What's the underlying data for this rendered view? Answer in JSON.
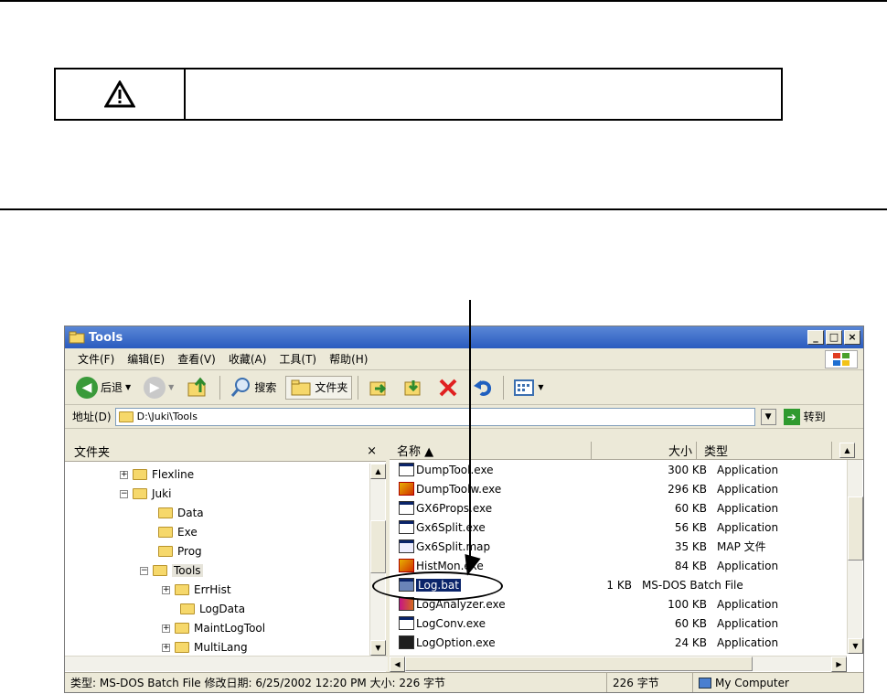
{
  "window": {
    "title": "Tools",
    "buttons": [
      "_",
      "□",
      "×"
    ]
  },
  "menu": [
    "文件(F)",
    "编辑(E)",
    "查看(V)",
    "收藏(A)",
    "工具(T)",
    "帮助(H)"
  ],
  "toolbar": {
    "back_label": "后退",
    "search_label": "搜索",
    "folders_label": "文件夹"
  },
  "address": {
    "label": "地址(D)",
    "value": "D:\\Juki\\Tools",
    "go_label": "转到"
  },
  "folders_pane": {
    "title": "文件夹",
    "close": "×",
    "nodes": [
      {
        "label": "Flexline",
        "expander": "+"
      },
      {
        "label": "Juki",
        "expander": "−"
      },
      {
        "label": "Data",
        "expander": ""
      },
      {
        "label": "Exe",
        "expander": ""
      },
      {
        "label": "Prog",
        "expander": ""
      },
      {
        "label": "Tools",
        "expander": "−"
      },
      {
        "label": "ErrHist",
        "expander": "+"
      },
      {
        "label": "LogData",
        "expander": ""
      },
      {
        "label": "MaintLogTool",
        "expander": "+"
      },
      {
        "label": "MultiLang",
        "expander": "+"
      }
    ]
  },
  "file_list": {
    "columns": {
      "name": "名称 ▲",
      "size": "大小",
      "type": "类型"
    },
    "rows": [
      {
        "name": "DumpTool.exe",
        "size": "300 KB",
        "type": "Application",
        "icon": "app"
      },
      {
        "name": "DumpToolw.exe",
        "size": "296 KB",
        "type": "Application",
        "icon": "color"
      },
      {
        "name": "GX6Props.exe",
        "size": "60 KB",
        "type": "Application",
        "icon": "app"
      },
      {
        "name": "Gx6Split.exe",
        "size": "56 KB",
        "type": "Application",
        "icon": "app"
      },
      {
        "name": "Gx6Split.map",
        "size": "35 KB",
        "type": "MAP 文件",
        "icon": "map"
      },
      {
        "name": "HistMon.exe",
        "size": "84 KB",
        "type": "Application",
        "icon": "color"
      },
      {
        "name": "Log.bat",
        "size": "1 KB",
        "type": "MS-DOS Batch File",
        "icon": "bat"
      },
      {
        "name": "LogAnalyzer.exe",
        "size": "100 KB",
        "type": "Application",
        "icon": "la"
      },
      {
        "name": "LogConv.exe",
        "size": "60 KB",
        "type": "Application",
        "icon": "app"
      },
      {
        "name": "LogOption.exe",
        "size": "24 KB",
        "type": "Application",
        "icon": "lo"
      }
    ],
    "selected_row": "Log.bat"
  },
  "status": {
    "details": "类型: MS-DOS Batch File 修改日期: 6/25/2002 12:20 PM 大小: 226 字节",
    "size": "226 字节",
    "zone": "My Computer"
  },
  "warning_icon": "warning-triangle-icon"
}
